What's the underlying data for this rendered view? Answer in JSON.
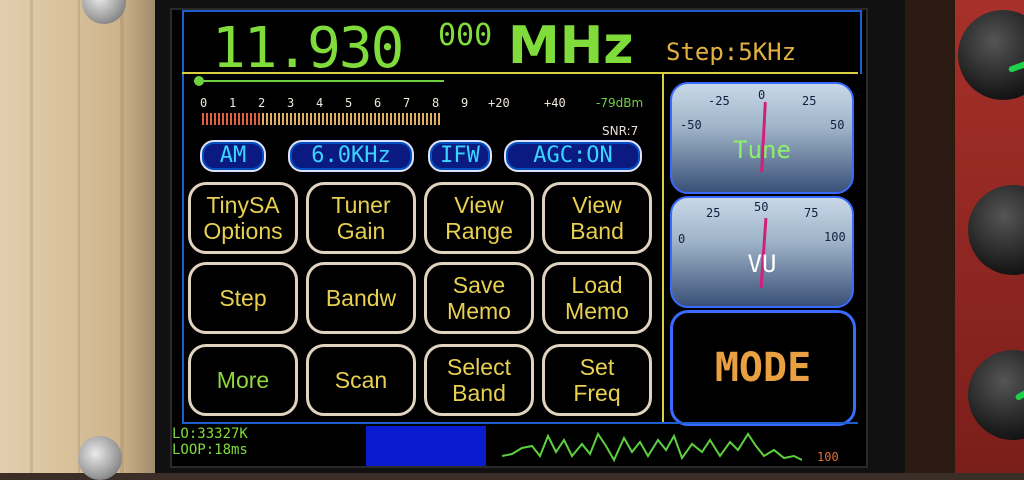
{
  "frequency": {
    "main": "11.930",
    "sub": "000",
    "unit": "MHz"
  },
  "step": "Step:5KHz",
  "smeter": {
    "scale": [
      "0",
      "1",
      "2",
      "3",
      "4",
      "5",
      "6",
      "7",
      "8",
      "9",
      "+20",
      "+40"
    ],
    "level_dbm": "-79dBm",
    "snr": "SNR:7"
  },
  "status_pills": {
    "mode": "AM",
    "bandwidth": "6.0KHz",
    "ifw": "IFW",
    "agc": "AGC:ON"
  },
  "buttons": [
    {
      "label1": "TinySA",
      "label2": "Options"
    },
    {
      "label1": "Tuner",
      "label2": "Gain"
    },
    {
      "label1": "View",
      "label2": "Range"
    },
    {
      "label1": "View",
      "label2": "Band"
    },
    {
      "label1": "Step",
      "label2": ""
    },
    {
      "label1": "Bandw",
      "label2": ""
    },
    {
      "label1": "Save",
      "label2": "Memo"
    },
    {
      "label1": "Load",
      "label2": "Memo"
    },
    {
      "label1": "More",
      "label2": ""
    },
    {
      "label1": "Scan",
      "label2": ""
    },
    {
      "label1": "Select",
      "label2": "Band"
    },
    {
      "label1": "Set",
      "label2": "Freq"
    }
  ],
  "tune_meter": {
    "label": "Tune",
    "scale": [
      "-50",
      "-25",
      "0",
      "25",
      "50"
    ]
  },
  "vu_meter": {
    "label": "VU",
    "scale": [
      "0",
      "25",
      "50",
      "75",
      "100"
    ]
  },
  "mode_button": "MODE",
  "status": {
    "lo": "LO:33327K",
    "loop": "LOOP:18ms",
    "wave_end": "100"
  }
}
